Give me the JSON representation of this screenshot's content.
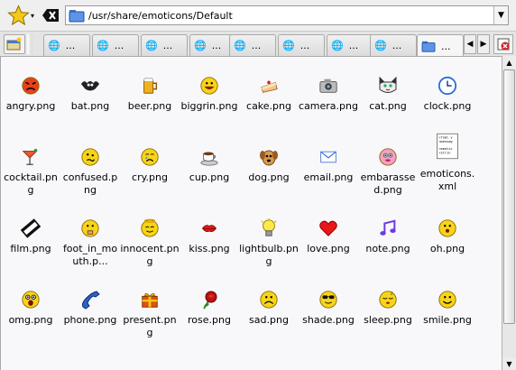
{
  "location": {
    "path": "/usr/share/emoticons/Default"
  },
  "tabs": [
    {
      "label": "..."
    },
    {
      "label": "..."
    },
    {
      "label": "..."
    },
    {
      "label": "..."
    },
    {
      "label": "..."
    },
    {
      "label": "..."
    },
    {
      "label": "..."
    },
    {
      "label": "..."
    },
    {
      "label": "..."
    }
  ],
  "files": [
    {
      "name": "angry.png",
      "icon": "angry-face-icon"
    },
    {
      "name": "bat.png",
      "icon": "bat-icon"
    },
    {
      "name": "beer.png",
      "icon": "beer-icon"
    },
    {
      "name": "biggrin.png",
      "icon": "biggrin-face-icon"
    },
    {
      "name": "cake.png",
      "icon": "cake-icon"
    },
    {
      "name": "camera.png",
      "icon": "camera-icon"
    },
    {
      "name": "cat.png",
      "icon": "cat-icon"
    },
    {
      "name": "clock.png",
      "icon": "clock-icon"
    },
    {
      "name": "cocktail.png",
      "icon": "cocktail-icon"
    },
    {
      "name": "confused.png",
      "icon": "confused-face-icon"
    },
    {
      "name": "cry.png",
      "icon": "cry-face-icon"
    },
    {
      "name": "cup.png",
      "icon": "cup-icon"
    },
    {
      "name": "dog.png",
      "icon": "dog-icon"
    },
    {
      "name": "email.png",
      "icon": "email-icon"
    },
    {
      "name": "embarassed.png",
      "icon": "embarassed-face-icon"
    },
    {
      "name": "emoticons.xml",
      "icon": "xml-file-icon"
    },
    {
      "name": "film.png",
      "icon": "film-icon"
    },
    {
      "name": "foot_in_mouth.p...",
      "icon": "foot-in-mouth-face-icon"
    },
    {
      "name": "innocent.png",
      "icon": "innocent-face-icon"
    },
    {
      "name": "kiss.png",
      "icon": "kiss-icon"
    },
    {
      "name": "lightbulb.png",
      "icon": "lightbulb-icon"
    },
    {
      "name": "love.png",
      "icon": "heart-icon"
    },
    {
      "name": "note.png",
      "icon": "music-note-icon"
    },
    {
      "name": "oh.png",
      "icon": "oh-face-icon"
    },
    {
      "name": "omg.png",
      "icon": "omg-face-icon"
    },
    {
      "name": "phone.png",
      "icon": "phone-icon"
    },
    {
      "name": "present.png",
      "icon": "present-icon"
    },
    {
      "name": "rose.png",
      "icon": "rose-icon"
    },
    {
      "name": "sad.png",
      "icon": "sad-face-icon"
    },
    {
      "name": "shade.png",
      "icon": "shade-face-icon"
    },
    {
      "name": "sleep.png",
      "icon": "sleep-face-icon"
    },
    {
      "name": "smile.png",
      "icon": "smile-face-icon"
    }
  ],
  "colors": {
    "face_yellow": "#f7d417",
    "angry_red": "#e8401c",
    "heart_red": "#e81818",
    "note_purple": "#6a3ce0",
    "email_blue": "#3a6fd8"
  }
}
